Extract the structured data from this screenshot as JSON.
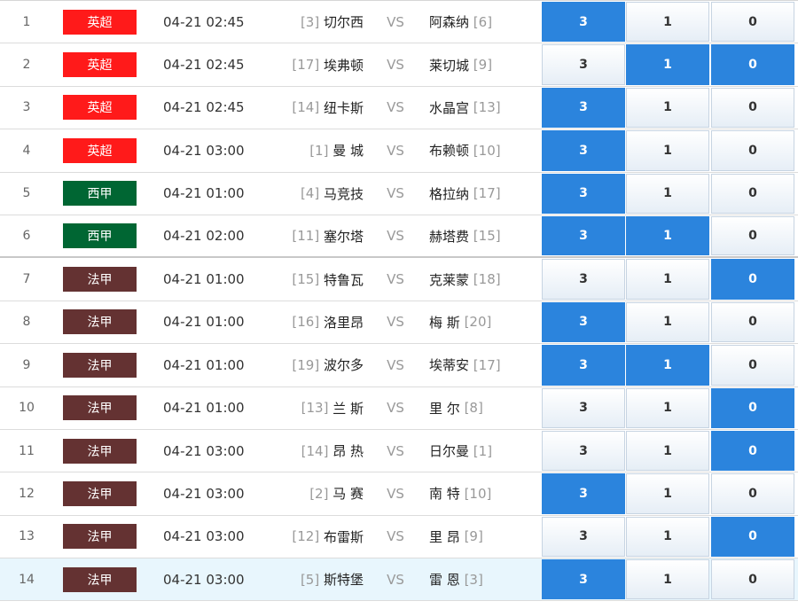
{
  "colors": {
    "premier_league": "#ff1a1a",
    "la_liga": "#006633",
    "ligue_1": "#643232",
    "selected_option": "#2b84dd",
    "highlight_row": "#e8f6fd"
  },
  "vs_label": "VS",
  "matches": [
    {
      "index": "1",
      "league": "英超",
      "league_color": "#ff1a1a",
      "time": "04-21 02:45",
      "home_rank": "[3]",
      "home": "切尔西",
      "away": "阿森纳",
      "away_rank": "[6]",
      "opt1": "3",
      "opt2": "1",
      "opt3": "0",
      "selected": [
        "3"
      ]
    },
    {
      "index": "2",
      "league": "英超",
      "league_color": "#ff1a1a",
      "time": "04-21 02:45",
      "home_rank": "[17]",
      "home": "埃弗顿",
      "away": "莱切城",
      "away_rank": "[9]",
      "opt1": "3",
      "opt2": "1",
      "opt3": "0",
      "selected": [
        "1",
        "0"
      ]
    },
    {
      "index": "3",
      "league": "英超",
      "league_color": "#ff1a1a",
      "time": "04-21 02:45",
      "home_rank": "[14]",
      "home": "纽卡斯",
      "away": "水晶宫",
      "away_rank": "[13]",
      "opt1": "3",
      "opt2": "1",
      "opt3": "0",
      "selected": [
        "3"
      ]
    },
    {
      "index": "4",
      "league": "英超",
      "league_color": "#ff1a1a",
      "time": "04-21 03:00",
      "home_rank": "[1]",
      "home": "曼 城",
      "away": "布赖顿",
      "away_rank": "[10]",
      "opt1": "3",
      "opt2": "1",
      "opt3": "0",
      "selected": [
        "3"
      ]
    },
    {
      "index": "5",
      "league": "西甲",
      "league_color": "#006633",
      "time": "04-21 01:00",
      "home_rank": "[4]",
      "home": "马竞技",
      "away": "格拉纳",
      "away_rank": "[17]",
      "opt1": "3",
      "opt2": "1",
      "opt3": "0",
      "selected": [
        "3"
      ]
    },
    {
      "index": "6",
      "league": "西甲",
      "league_color": "#006633",
      "time": "04-21 02:00",
      "home_rank": "[11]",
      "home": "塞尔塔",
      "away": "赫塔费",
      "away_rank": "[15]",
      "opt1": "3",
      "opt2": "1",
      "opt3": "0",
      "selected": [
        "3",
        "1"
      ]
    },
    {
      "index": "7",
      "league": "法甲",
      "league_color": "#643232",
      "time": "04-21 01:00",
      "home_rank": "[15]",
      "home": "特鲁瓦",
      "away": "克莱蒙",
      "away_rank": "[18]",
      "opt1": "3",
      "opt2": "1",
      "opt3": "0",
      "selected": [
        "0"
      ]
    },
    {
      "index": "8",
      "league": "法甲",
      "league_color": "#643232",
      "time": "04-21 01:00",
      "home_rank": "[16]",
      "home": "洛里昂",
      "away": "梅 斯",
      "away_rank": "[20]",
      "opt1": "3",
      "opt2": "1",
      "opt3": "0",
      "selected": [
        "3"
      ]
    },
    {
      "index": "9",
      "league": "法甲",
      "league_color": "#643232",
      "time": "04-21 01:00",
      "home_rank": "[19]",
      "home": "波尔多",
      "away": "埃蒂安",
      "away_rank": "[17]",
      "opt1": "3",
      "opt2": "1",
      "opt3": "0",
      "selected": [
        "3",
        "1"
      ]
    },
    {
      "index": "10",
      "league": "法甲",
      "league_color": "#643232",
      "time": "04-21 01:00",
      "home_rank": "[13]",
      "home": "兰 斯",
      "away": "里 尔",
      "away_rank": "[8]",
      "opt1": "3",
      "opt2": "1",
      "opt3": "0",
      "selected": [
        "0"
      ]
    },
    {
      "index": "11",
      "league": "法甲",
      "league_color": "#643232",
      "time": "04-21 03:00",
      "home_rank": "[14]",
      "home": "昂 热",
      "away": "日尔曼",
      "away_rank": "[1]",
      "opt1": "3",
      "opt2": "1",
      "opt3": "0",
      "selected": [
        "0"
      ]
    },
    {
      "index": "12",
      "league": "法甲",
      "league_color": "#643232",
      "time": "04-21 03:00",
      "home_rank": "[2]",
      "home": "马 赛",
      "away": "南 特",
      "away_rank": "[10]",
      "opt1": "3",
      "opt2": "1",
      "opt3": "0",
      "selected": [
        "3"
      ]
    },
    {
      "index": "13",
      "league": "法甲",
      "league_color": "#643232",
      "time": "04-21 03:00",
      "home_rank": "[12]",
      "home": "布雷斯",
      "away": "里 昂",
      "away_rank": "[9]",
      "opt1": "3",
      "opt2": "1",
      "opt3": "0",
      "selected": [
        "0"
      ]
    },
    {
      "index": "14",
      "league": "法甲",
      "league_color": "#643232",
      "time": "04-21 03:00",
      "home_rank": "[5]",
      "home": "斯特堡",
      "away": "雷 恩",
      "away_rank": "[3]",
      "opt1": "3",
      "opt2": "1",
      "opt3": "0",
      "selected": [
        "3"
      ],
      "highlighted": true
    }
  ]
}
